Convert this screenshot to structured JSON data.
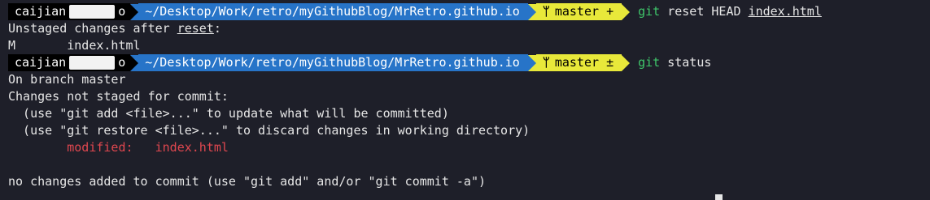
{
  "prompt1": {
    "user": "caijian",
    "user_suffix": "o",
    "path": "~/Desktop/Work/retro/myGithubBlog/MrRetro.github.io",
    "branch_icon": "ᛘ",
    "branch": "master",
    "branch_status": "+",
    "cmd": "git",
    "args_prefix": "reset HEAD ",
    "args_file": "index.html"
  },
  "out1": {
    "line1_prefix": "Unstaged changes after ",
    "line1_word": "reset",
    "line1_suffix": ":",
    "line2": "M       index.html"
  },
  "prompt2": {
    "user": "caijian",
    "user_suffix": "o",
    "path": "~/Desktop/Work/retro/myGithubBlog/MrRetro.github.io",
    "branch_icon": "ᛘ",
    "branch": "master",
    "branch_status": "±",
    "cmd": "git",
    "args": "status"
  },
  "out2": {
    "line1": "On branch master",
    "line2": "Changes not staged for commit:",
    "line3": "  (use \"git add <file>...\" to update what will be committed)",
    "line4": "  (use \"git restore <file>...\" to discard changes in working directory)",
    "line5_label": "        modified:   ",
    "line5_file": "index.html",
    "line6": "",
    "line7": "no changes added to commit (use \"git add\" and/or \"git commit -a\")"
  },
  "colors": {
    "background": "#1e1f29",
    "user_segment": "#000000",
    "path_segment": "#2774c8",
    "branch_segment": "#e8e83a",
    "git_command": "#3fc56a",
    "modified": "#e0474f"
  }
}
